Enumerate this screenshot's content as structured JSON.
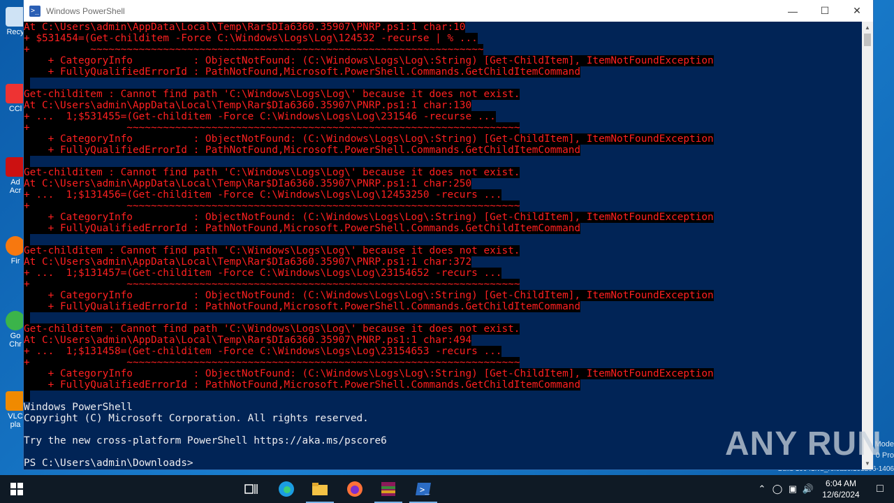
{
  "window": {
    "title": "Windows PowerShell"
  },
  "desktop_icons": [
    {
      "label": "Recy"
    },
    {
      "label": "CCl"
    },
    {
      "label": "Ad"
    },
    {
      "label": "Acr"
    },
    {
      "label": "Fir"
    },
    {
      "label": "Go"
    },
    {
      "label": "Chr"
    },
    {
      "label": "VLC"
    },
    {
      "label": "pla"
    }
  ],
  "watermark": {
    "line1": "Mode",
    "line2": "0 Pro",
    "line3": "Build 19041.vb_release.191206-1406"
  },
  "console_lines": [
    {
      "type": "err",
      "text": "At C:\\Users\\admin\\AppData\\Local\\Temp\\Rar$DIa6360.35907\\PNRP.ps1:1 char:10"
    },
    {
      "type": "err",
      "text": "+ $531454=(Get-childitem -Force C:\\Windows\\Logs\\Log\\124532 -recurse | % ..."
    },
    {
      "type": "err",
      "text": "+          ~~~~~~~~~~~~~~~~~~~~~~~~~~~~~~~~~~~~~~~~~~~~~~~~~~~~~~~~~~~~~~~~~"
    },
    {
      "type": "err",
      "text": "    + CategoryInfo          : ObjectNotFound: (C:\\Windows\\Logs\\Log\\:String) [Get-ChildItem], ItemNotFoundException"
    },
    {
      "type": "err",
      "text": "    + FullyQualifiedErrorId : PathNotFound,Microsoft.PowerShell.Commands.GetChildItemCommand"
    },
    {
      "type": "err",
      "text": " "
    },
    {
      "type": "err",
      "text": "Get-childitem : Cannot find path 'C:\\Windows\\Logs\\Log\\' because it does not exist."
    },
    {
      "type": "err",
      "text": "At C:\\Users\\admin\\AppData\\Local\\Temp\\Rar$DIa6360.35907\\PNRP.ps1:1 char:130"
    },
    {
      "type": "err",
      "text": "+ ...  1;$531455=(Get-childitem -Force C:\\Windows\\Logs\\Log\\231546 -recurse ..."
    },
    {
      "type": "err",
      "text": "+                ~~~~~~~~~~~~~~~~~~~~~~~~~~~~~~~~~~~~~~~~~~~~~~~~~~~~~~~~~~~~~~~~~"
    },
    {
      "type": "err",
      "text": "    + CategoryInfo          : ObjectNotFound: (C:\\Windows\\Logs\\Log\\:String) [Get-ChildItem], ItemNotFoundException"
    },
    {
      "type": "err",
      "text": "    + FullyQualifiedErrorId : PathNotFound,Microsoft.PowerShell.Commands.GetChildItemCommand"
    },
    {
      "type": "err",
      "text": " "
    },
    {
      "type": "err",
      "text": "Get-childitem : Cannot find path 'C:\\Windows\\Logs\\Log\\' because it does not exist."
    },
    {
      "type": "err",
      "text": "At C:\\Users\\admin\\AppData\\Local\\Temp\\Rar$DIa6360.35907\\PNRP.ps1:1 char:250"
    },
    {
      "type": "err",
      "text": "+ ...  1;$131456=(Get-childitem -Force C:\\Windows\\Logs\\Log\\12453250 -recurs ..."
    },
    {
      "type": "err",
      "text": "+                ~~~~~~~~~~~~~~~~~~~~~~~~~~~~~~~~~~~~~~~~~~~~~~~~~~~~~~~~~~~~~~~~~"
    },
    {
      "type": "err",
      "text": "    + CategoryInfo          : ObjectNotFound: (C:\\Windows\\Logs\\Log\\:String) [Get-ChildItem], ItemNotFoundException"
    },
    {
      "type": "err",
      "text": "    + FullyQualifiedErrorId : PathNotFound,Microsoft.PowerShell.Commands.GetChildItemCommand"
    },
    {
      "type": "err",
      "text": " "
    },
    {
      "type": "err",
      "text": "Get-childitem : Cannot find path 'C:\\Windows\\Logs\\Log\\' because it does not exist."
    },
    {
      "type": "err",
      "text": "At C:\\Users\\admin\\AppData\\Local\\Temp\\Rar$DIa6360.35907\\PNRP.ps1:1 char:372"
    },
    {
      "type": "err",
      "text": "+ ...  1;$131457=(Get-childitem -Force C:\\Windows\\Logs\\Log\\23154652 -recurs ..."
    },
    {
      "type": "err",
      "text": "+                ~~~~~~~~~~~~~~~~~~~~~~~~~~~~~~~~~~~~~~~~~~~~~~~~~~~~~~~~~~~~~~~~~"
    },
    {
      "type": "err",
      "text": "    + CategoryInfo          : ObjectNotFound: (C:\\Windows\\Logs\\Log\\:String) [Get-ChildItem], ItemNotFoundException"
    },
    {
      "type": "err",
      "text": "    + FullyQualifiedErrorId : PathNotFound,Microsoft.PowerShell.Commands.GetChildItemCommand"
    },
    {
      "type": "err",
      "text": " "
    },
    {
      "type": "err",
      "text": "Get-childitem : Cannot find path 'C:\\Windows\\Logs\\Log\\' because it does not exist."
    },
    {
      "type": "err",
      "text": "At C:\\Users\\admin\\AppData\\Local\\Temp\\Rar$DIa6360.35907\\PNRP.ps1:1 char:494"
    },
    {
      "type": "err",
      "text": "+ ...  1;$131458=(Get-childitem -Force C:\\Windows\\Logs\\Log\\23154653 -recurs ..."
    },
    {
      "type": "err",
      "text": "+                ~~~~~~~~~~~~~~~~~~~~~~~~~~~~~~~~~~~~~~~~~~~~~~~~~~~~~~~~~~~~~~~~~"
    },
    {
      "type": "err",
      "text": "    + CategoryInfo          : ObjectNotFound: (C:\\Windows\\Logs\\Log\\:String) [Get-ChildItem], ItemNotFoundException"
    },
    {
      "type": "err",
      "text": "    + FullyQualifiedErrorId : PathNotFound,Microsoft.PowerShell.Commands.GetChildItemCommand"
    },
    {
      "type": "err",
      "text": " "
    },
    {
      "type": "norm",
      "text": "Windows PowerShell"
    },
    {
      "type": "norm",
      "text": "Copyright (C) Microsoft Corporation. All rights reserved."
    },
    {
      "type": "norm",
      "text": ""
    },
    {
      "type": "norm",
      "text": "Try the new cross-platform PowerShell https://aka.ms/pscore6"
    },
    {
      "type": "norm",
      "text": ""
    }
  ],
  "prompt": "PS C:\\Users\\admin\\Downloads> ",
  "branding": "ANY RUN",
  "taskbar": {
    "apps": [
      "start-button",
      "task-view",
      "edge",
      "file-explorer",
      "firefox",
      "winrar",
      "powershell"
    ]
  },
  "clock": {
    "time": "6:04 AM",
    "date": "12/6/2024"
  },
  "colors": {
    "console_bg": "#012456",
    "error_text": "#ff2020",
    "taskbar_bg": "#0f1a25"
  }
}
